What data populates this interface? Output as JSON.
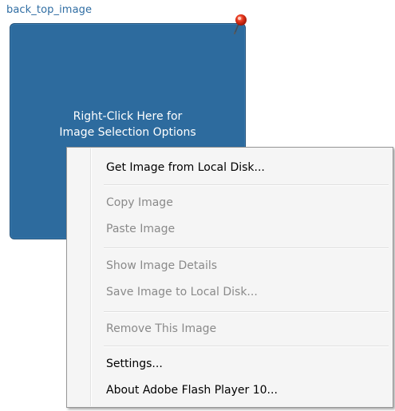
{
  "field": {
    "label": "back_top_image"
  },
  "image_panel": {
    "hint_line1": "Right-Click Here for",
    "hint_line2": "Image Selection Options",
    "background_color": "#2d6b9e"
  },
  "pin": {
    "icon": "push-pin-icon",
    "color": "#e8391f"
  },
  "context_menu": {
    "items": [
      {
        "label": "Get Image from Local Disk...",
        "enabled": true
      },
      {
        "label": "Copy Image",
        "enabled": false
      },
      {
        "label": "Paste Image",
        "enabled": false
      },
      {
        "label": "Show Image Details",
        "enabled": false
      },
      {
        "label": "Save Image to Local Disk...",
        "enabled": false
      },
      {
        "label": "Remove This Image",
        "enabled": false
      },
      {
        "label": "Settings...",
        "enabled": true
      },
      {
        "label": "About Adobe Flash Player 10...",
        "enabled": true
      }
    ]
  }
}
